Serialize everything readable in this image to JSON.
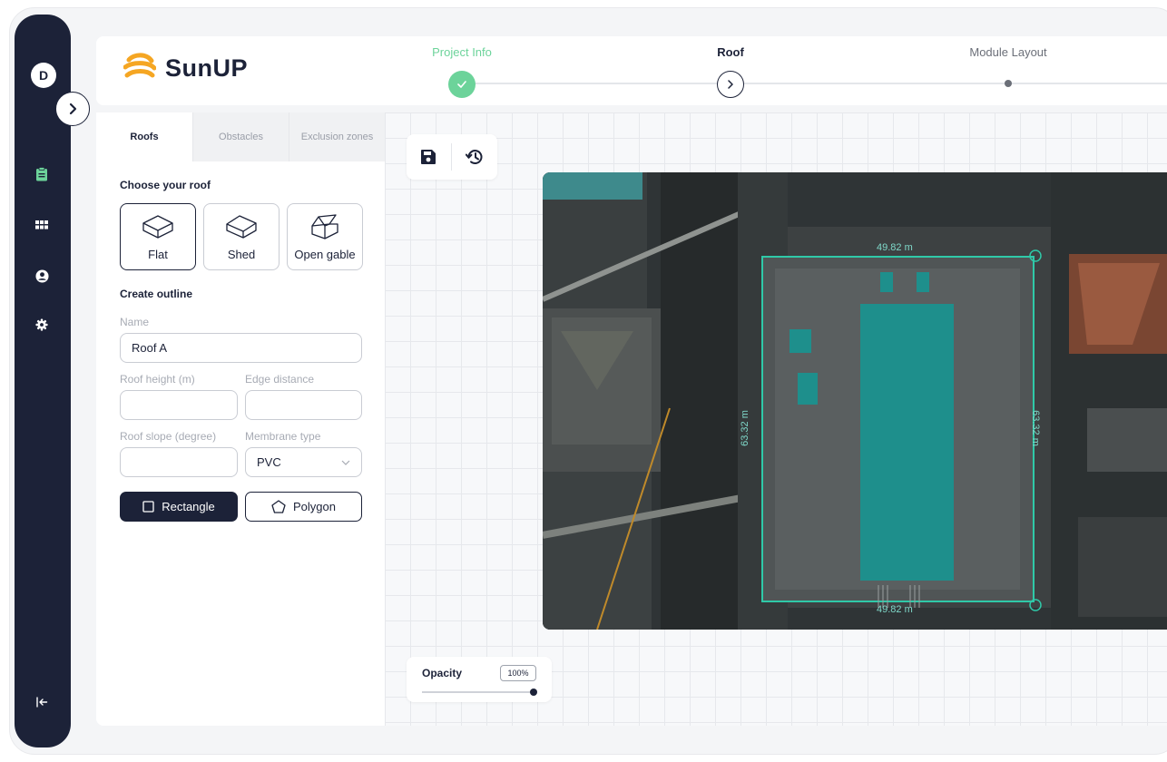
{
  "app": {
    "brand": "SunUP",
    "user_initial": "D"
  },
  "colors": {
    "primary": "#1c2238",
    "accent": "#2fae98",
    "done": "#6cd39a",
    "brand_orange": "#f5a623"
  },
  "rail": {
    "items": [
      {
        "name": "clipboard-icon",
        "active": true
      },
      {
        "name": "grid-icon",
        "active": false
      },
      {
        "name": "user-icon",
        "active": false
      },
      {
        "name": "gear-icon",
        "active": false
      }
    ],
    "logout_icon": "logout-icon"
  },
  "steps": [
    {
      "label": "Project Info",
      "state": "done"
    },
    {
      "label": "Roof",
      "state": "current"
    },
    {
      "label": "Module Layout",
      "state": "upcoming"
    }
  ],
  "tabs": [
    {
      "label": "Roofs",
      "active": true
    },
    {
      "label": "Obstacles",
      "active": false
    },
    {
      "label": "Exclusion zones",
      "active": false
    }
  ],
  "roof": {
    "choose_title": "Choose your roof",
    "options": [
      {
        "label": "Flat",
        "selected": true
      },
      {
        "label": "Shed",
        "selected": false
      },
      {
        "label": "Open gable",
        "selected": false
      }
    ]
  },
  "outline": {
    "title": "Create outline",
    "name_label": "Name",
    "name_value": "Roof A",
    "height_label": "Roof height (m)",
    "height_value": "",
    "edge_label": "Edge distance",
    "edge_value": "",
    "slope_label": "Roof slope (degree)",
    "slope_value": "",
    "membrane_label": "Membrane type",
    "membrane_value": "PVC",
    "rect_label": "Rectangle",
    "polygon_label": "Polygon"
  },
  "map": {
    "top_dimension": "49.82 m",
    "bottom_dimension": "49.82 m",
    "left_dimension": "63.32 m",
    "right_dimension": "63.32 m"
  },
  "opacity": {
    "label": "Opacity",
    "value_text": "100%",
    "value": 1.0
  }
}
